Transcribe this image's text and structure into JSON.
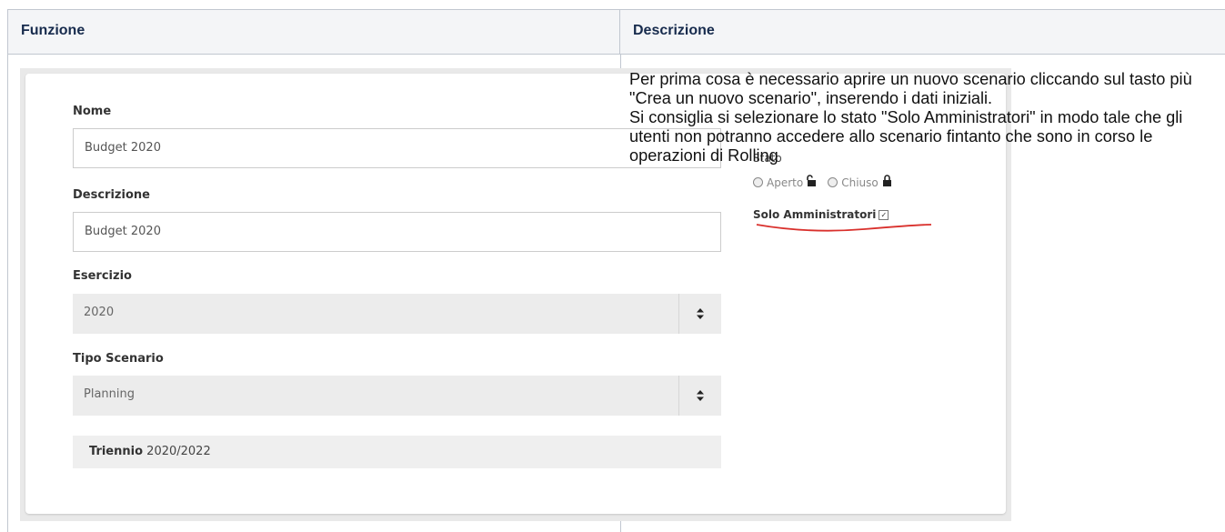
{
  "table": {
    "col1_header": "Funzione",
    "col2_header": "Descrizione"
  },
  "form": {
    "nome_label": "Nome",
    "nome_value": "Budget 2020",
    "descrizione_label": "Descrizione",
    "descrizione_value": "Budget 2020",
    "esercizio_label": "Esercizio",
    "esercizio_value": "2020",
    "tipo_label": "Tipo Scenario",
    "tipo_value": "Planning",
    "triennio_label": "Triennio",
    "triennio_value": "2020/2022",
    "stato_label": "Stato",
    "stato_aperto": "Aperto",
    "stato_chiuso": "Chiuso",
    "solo_admin_label": "Solo Amministratori",
    "solo_admin_checked": true
  },
  "description": {
    "para1": "Per prima cosa è necessario aprire un nuovo scenario cliccando sul tasto più \"Crea un nuovo scenario\", inserendo i dati iniziali.",
    "para2": "Si consiglia si selezionare lo stato \"Solo Amministratori\" in modo tale che gli utenti non potranno accedere allo scenario fintanto che sono in corso le operazioni di Rolling"
  },
  "colors": {
    "header_bg": "#f4f5f7",
    "border": "#c1c7d0",
    "annotation_red": "#d9302c"
  },
  "icons": [
    "sort-arrows-icon",
    "unlock-icon",
    "lock-icon",
    "checkbox-icon"
  ]
}
